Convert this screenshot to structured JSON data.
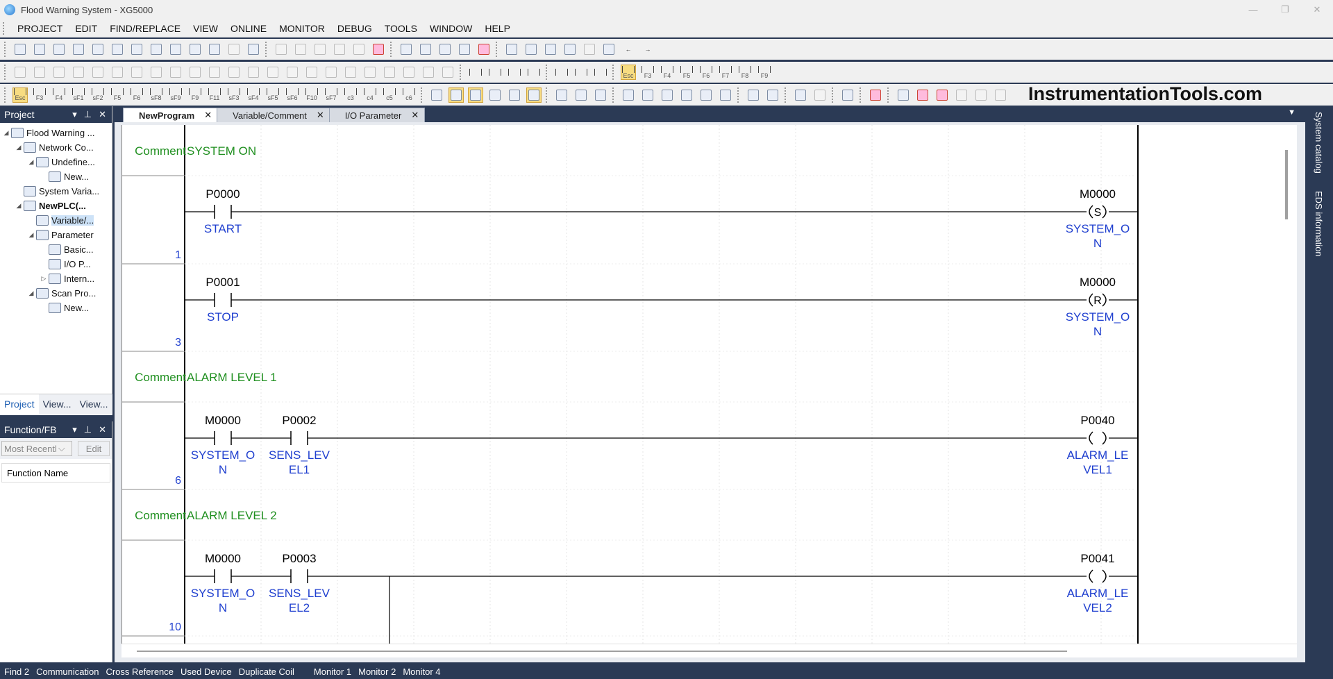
{
  "window": {
    "title": "Flood Warning System - XG5000",
    "controls": [
      "—",
      "❐",
      "✕"
    ]
  },
  "menu": [
    "PROJECT",
    "EDIT",
    "FIND/REPLACE",
    "VIEW",
    "ONLINE",
    "MONITOR",
    "DEBUG",
    "TOOLS",
    "WINDOW",
    "HELP"
  ],
  "toolbar3_keys": [
    "Esc",
    "F3",
    "F4",
    "sF1",
    "sF2",
    "F5",
    "F6",
    "sF8",
    "sF9",
    "F9",
    "F11",
    "sF3",
    "sF4",
    "sF5",
    "sF6",
    "F10",
    "sF7",
    "c3",
    "c4",
    "c5",
    "c6"
  ],
  "toolbar2_keys": [
    "Esc",
    "F3",
    "F4",
    "F5",
    "F6",
    "F7",
    "F8",
    "F9"
  ],
  "brand": "InstrumentationTools.com",
  "project_panel": {
    "title": "Project",
    "tree": [
      {
        "label": "Flood Warning ...",
        "level": 0,
        "expander": "◢",
        "bold": false
      },
      {
        "label": "Network Co...",
        "level": 1,
        "expander": "◢",
        "bold": false
      },
      {
        "label": "Undefine...",
        "level": 2,
        "expander": "◢",
        "bold": false
      },
      {
        "label": "New...",
        "level": 3,
        "expander": "",
        "bold": false
      },
      {
        "label": "System Varia...",
        "level": 1,
        "expander": "",
        "bold": false
      },
      {
        "label": "NewPLC(...",
        "level": 1,
        "expander": "◢",
        "bold": true
      },
      {
        "label": "Variable/...",
        "level": 2,
        "expander": "",
        "bold": false,
        "selected": true
      },
      {
        "label": "Parameter",
        "level": 2,
        "expander": "◢",
        "bold": false
      },
      {
        "label": "Basic...",
        "level": 3,
        "expander": "",
        "bold": false
      },
      {
        "label": "I/O P...",
        "level": 3,
        "expander": "",
        "bold": false
      },
      {
        "label": "Intern...",
        "level": 3,
        "expander": "▷",
        "bold": false
      },
      {
        "label": "Scan Pro...",
        "level": 2,
        "expander": "◢",
        "bold": false
      },
      {
        "label": "New...",
        "level": 3,
        "expander": "",
        "bold": false
      }
    ],
    "tabs": [
      "Project",
      "View...",
      "View..."
    ]
  },
  "fb_panel": {
    "title": "Function/FB",
    "select": "Most Recentl",
    "edit": "Edit",
    "column": "Function Name"
  },
  "doc_tabs": [
    "NewProgram",
    "Variable/Comment",
    "I/O Parameter"
  ],
  "side_tabs": [
    "System catalog",
    "EDS information"
  ],
  "status_tabs": [
    "Find 2",
    "Communication",
    "Cross Reference",
    "Used Device",
    "Duplicate Coil",
    "Monitor 1",
    "Monitor 2",
    "Monitor 4"
  ],
  "ladder": [
    {
      "type": "comment",
      "label": "Comment",
      "text": "SYSTEM ON"
    },
    {
      "type": "rung",
      "step": "1",
      "contacts": [
        {
          "addr": "P0000",
          "name": [
            "START"
          ]
        }
      ],
      "coil": {
        "addr": "M0000",
        "kind": "S",
        "name": [
          "SYSTEM_O",
          "N"
        ]
      }
    },
    {
      "type": "rung",
      "step": "3",
      "contacts": [
        {
          "addr": "P0001",
          "name": [
            "STOP"
          ]
        }
      ],
      "coil": {
        "addr": "M0000",
        "kind": "R",
        "name": [
          "SYSTEM_O",
          "N"
        ]
      }
    },
    {
      "type": "comment",
      "label": "Comment",
      "text": "ALARM LEVEL 1"
    },
    {
      "type": "rung",
      "step": "6",
      "contacts": [
        {
          "addr": "M0000",
          "name": [
            "SYSTEM_O",
            "N"
          ]
        },
        {
          "addr": "P0002",
          "name": [
            "SENS_LEV",
            "EL1"
          ]
        }
      ],
      "coil": {
        "addr": "P0040",
        "kind": "",
        "name": [
          "ALARM_LE",
          "VEL1"
        ]
      }
    },
    {
      "type": "comment",
      "label": "Comment",
      "text": "ALARM LEVEL 2"
    },
    {
      "type": "rung",
      "step": "10",
      "contacts": [
        {
          "addr": "M0000",
          "name": [
            "SYSTEM_O",
            "N"
          ]
        },
        {
          "addr": "P0003",
          "name": [
            "SENS_LEV",
            "EL2"
          ]
        }
      ],
      "coil": {
        "addr": "P0041",
        "kind": "",
        "name": [
          "ALARM_LE",
          "VEL2"
        ]
      },
      "branch_down": true
    }
  ],
  "colors": {
    "comment": "#1f8f1f",
    "device": "#1f3fcf",
    "panel_bg": "#2b3a55",
    "highlight": "#f7dc81"
  }
}
